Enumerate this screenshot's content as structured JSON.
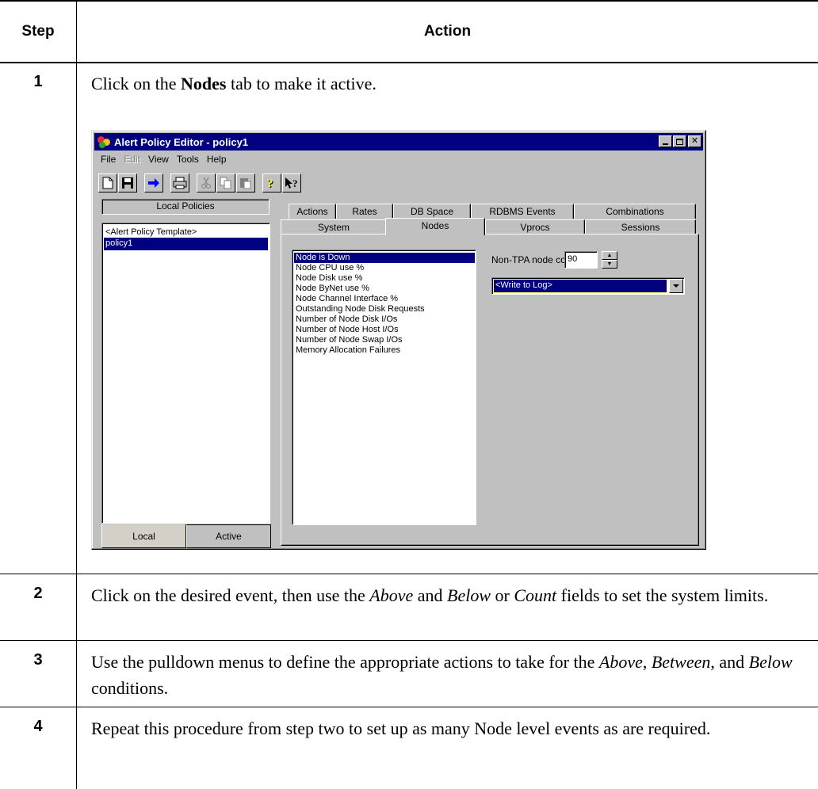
{
  "table": {
    "header_step": "Step",
    "header_action": "Action",
    "steps": [
      {
        "num": "1",
        "parts": [
          [
            "t",
            "Click on the "
          ],
          [
            "b",
            "Nodes"
          ],
          [
            "t",
            " tab to make it active."
          ]
        ]
      },
      {
        "num": "2",
        "parts": [
          [
            "t",
            "Click on the desired event, then use the "
          ],
          [
            "i",
            "Above"
          ],
          [
            "t",
            " and "
          ],
          [
            "i",
            "Below"
          ],
          [
            "t",
            " or "
          ],
          [
            "i",
            "Count"
          ],
          [
            "t",
            " fields to set the system limits."
          ]
        ]
      },
      {
        "num": "3",
        "parts": [
          [
            "t",
            "Use the pulldown menus to define the appropriate actions to take for the "
          ],
          [
            "i",
            "Above"
          ],
          [
            "t",
            ", "
          ],
          [
            "i",
            "Between"
          ],
          [
            "t",
            ", and "
          ],
          [
            "i",
            "Below"
          ],
          [
            "t",
            " conditions."
          ]
        ]
      },
      {
        "num": "4",
        "parts": [
          [
            "t",
            "Repeat this procedure from step two to set up as many Node level events as are required."
          ]
        ]
      }
    ]
  },
  "window": {
    "title": "Alert Policy Editor - policy1",
    "menu": [
      "File",
      "Edit",
      "View",
      "Tools",
      "Help"
    ],
    "menu_disabled": [
      "Edit"
    ],
    "toolbar_icons": [
      "new-file-icon",
      "save-icon",
      "arrow-right-icon",
      "print-icon",
      "cut-icon",
      "copy-icon",
      "paste-icon",
      "help-icon",
      "context-help-icon"
    ],
    "left_panel": {
      "header": "Local Policies",
      "items": [
        "<Alert Policy Template>",
        "policy1"
      ],
      "selected_index": 1,
      "tabs": [
        "Local",
        "Active"
      ]
    },
    "tabs_row1": [
      "Actions",
      "Rates",
      "DB Space",
      "RDBMS Events",
      "Combinations"
    ],
    "tabs_row2": [
      "System",
      "Nodes",
      "Vprocs",
      "Sessions"
    ],
    "active_tab": "Nodes",
    "events": [
      "Node is Down",
      "Node CPU use %",
      "Node Disk use %",
      "Node ByNet use %",
      "Node Channel Interface %",
      "Outstanding Node Disk Requests",
      "Number of Node Disk I/Os",
      "Number of Node Host I/Os",
      "Number of Node Swap I/Os",
      "Memory Allocation Failures"
    ],
    "selected_event_index": 0,
    "count_label": "Non-TPA node count",
    "count_value": "90",
    "action_value": "<Write to Log>",
    "colors": {
      "titlebar": "#000080",
      "face": "#c0c0c0",
      "selection": "#000080"
    }
  }
}
